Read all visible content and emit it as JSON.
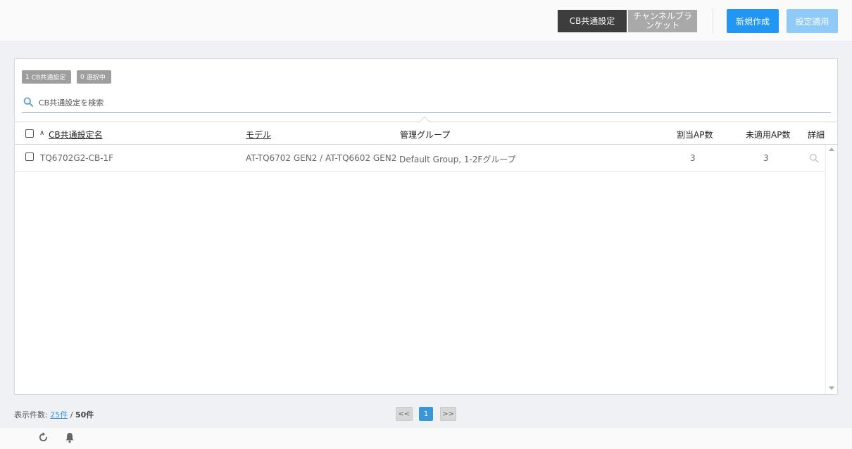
{
  "header": {
    "tabs": [
      {
        "label": "CB共通設定"
      },
      {
        "label": "チャンネルブランケット"
      }
    ],
    "new_button": "新規作成",
    "apply_button": "設定適用"
  },
  "panel": {
    "badge_total": {
      "count": "1",
      "label": "CB共通設定"
    },
    "badge_selected": {
      "count": "0",
      "label": "選択中"
    },
    "search_placeholder": "CB共通設定を検索"
  },
  "table": {
    "sort_indicator": "∧",
    "columns": {
      "name": "CB共通設定名",
      "model": "モデル",
      "group": "管理グループ",
      "assigned_ap": "割当AP数",
      "unapplied_ap": "未適用AP数",
      "detail": "詳細"
    },
    "rows": [
      {
        "name": "TQ6702G2-CB-1F",
        "model": "AT-TQ6702 GEN2 / AT-TQ6602 GEN2",
        "group": "Default Group, 1-2Fグループ",
        "assigned_ap": "3",
        "unapplied_ap": "3"
      }
    ]
  },
  "footer": {
    "count_label": "表示件数:",
    "per_page": "25件",
    "separator": "/",
    "total": "50件",
    "pagination": {
      "prev": "<<",
      "current": "1",
      "next": ">>"
    }
  },
  "icons": {
    "search": "search-icon",
    "detail": "magnifier-icon",
    "refresh": "refresh-icon",
    "notification": "bell-icon"
  },
  "colors": {
    "active_tab": "#3d3d3d",
    "inactive_tab": "#a9a9a9",
    "primary": "#2196f3",
    "primary_disabled": "#90caf9",
    "page_active": "#3a96d6"
  }
}
